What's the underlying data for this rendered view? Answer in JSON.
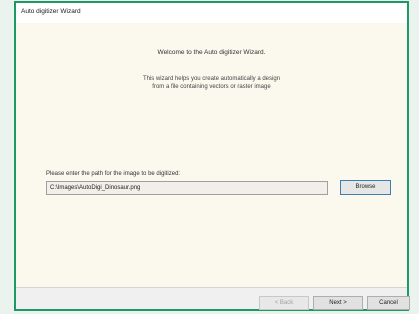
{
  "window": {
    "title": "Auto digitizer Wizard"
  },
  "intro": {
    "welcome": "Welcome to the Auto digitizer Wizard.",
    "description_line1": "This wizard helps you create automatically a design",
    "description_line2": "from a file containing vectors or raster image"
  },
  "path": {
    "label": "Please enter the path for the image to be digitized:",
    "value": "C:\\Images\\AutoDigi_Dinosaur.png",
    "browse_label": "Browse"
  },
  "footer": {
    "back_label": "< Back",
    "back_enabled": false,
    "next_label": "Next >",
    "cancel_label": "Cancel"
  },
  "colors": {
    "frame_accent": "#1b9a66",
    "content_background": "#fbf8ee",
    "focus_border": "#3c7fb1"
  }
}
